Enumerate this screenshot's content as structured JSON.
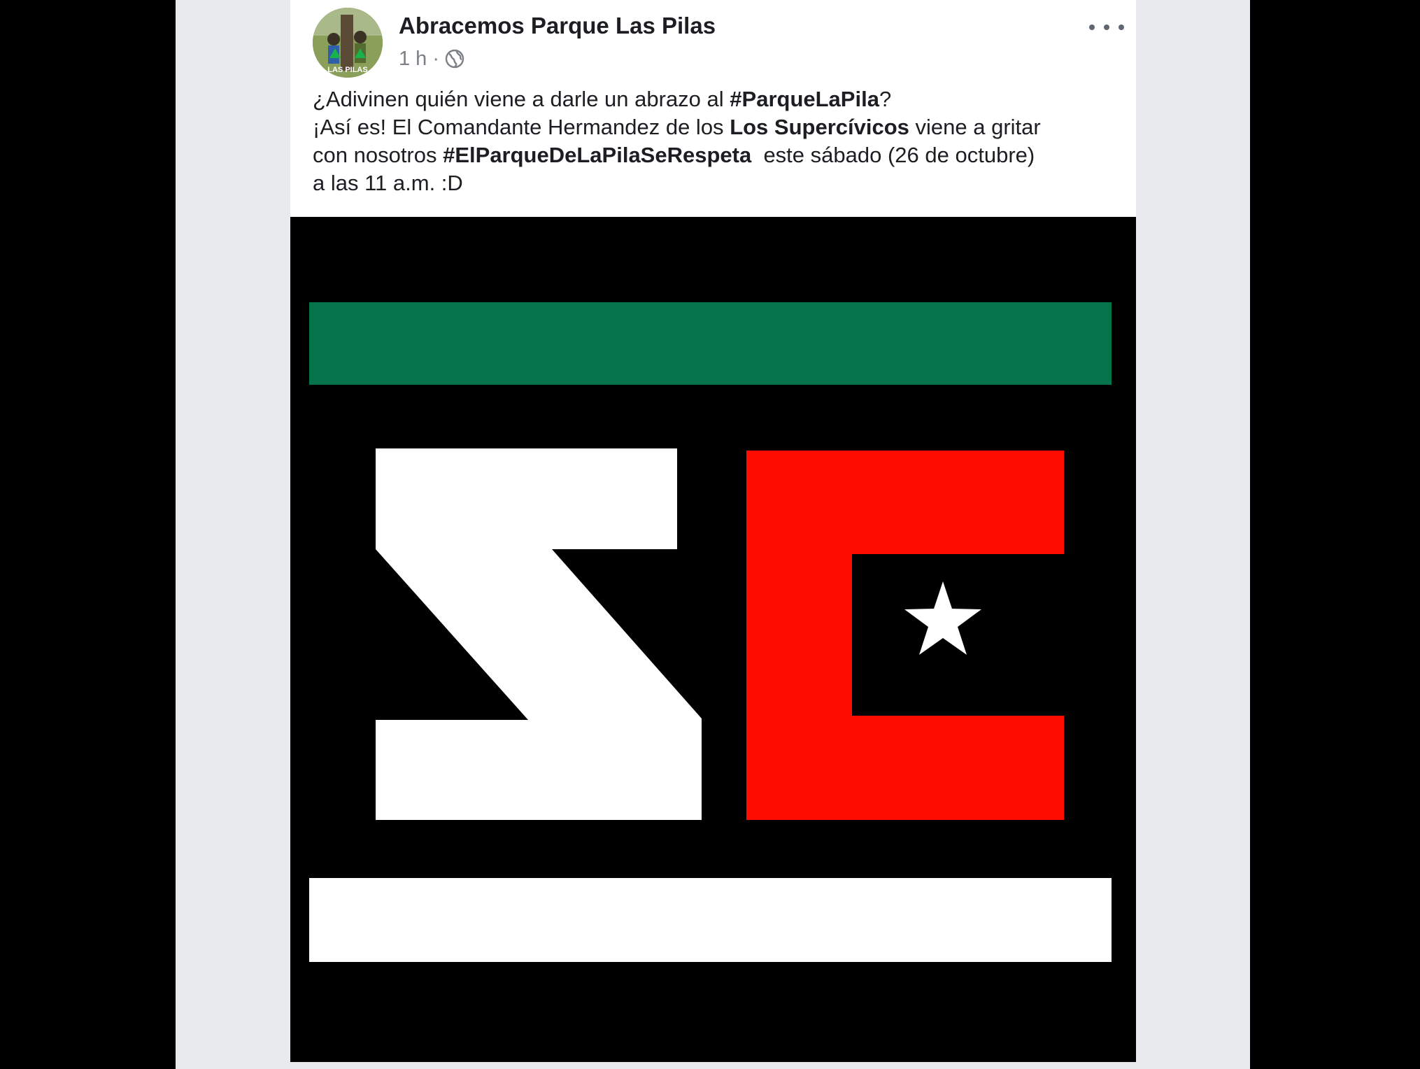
{
  "post": {
    "page_name": "Abracemos Parque Las Pilas",
    "timestamp": "1 h",
    "separator": "·",
    "audience_icon": "globe-icon",
    "more_icon": "more-options-icon",
    "avatar_text": "LAS PILAS",
    "text": {
      "line1_a": "¿Adivinen quién viene a darle un abrazo al ",
      "line1_hashtag": "#ParqueLaPila",
      "line1_b": "?",
      "line2_a": "¡Así es! El Comandante Hermandez de los ",
      "line2_bold": "Los Supercívicos",
      "line2_b": " viene a gritar",
      "line3_a": "con nosotros ",
      "line3_hashtag": "#ElParqueDeLaPilaSeRespeta",
      "line3_b": "  este sábado (26 de octubre)",
      "line4": "a las 11 a.m. :D"
    }
  },
  "image": {
    "description_icon": "los-supercivicos-logo",
    "colors": {
      "background": "#000000",
      "green": "#06744a",
      "white": "#ffffff",
      "red": "#ff0c00"
    }
  }
}
